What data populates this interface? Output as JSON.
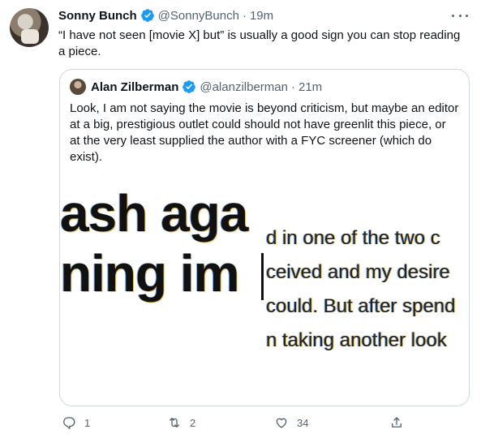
{
  "tweet": {
    "name": "Sonny Bunch",
    "handle": "@SonnyBunch",
    "separator": "·",
    "time": "19m",
    "text": "“I have not seen [movie X] but” is usually a good sign you can stop reading a piece."
  },
  "quote": {
    "name": "Alan Zilberman",
    "handle": "@alanzilberman",
    "separator": "·",
    "time": "21m",
    "text": "Look, I am not saying the movie is beyond criticism, but maybe an editor at a big, prestigious outlet could should not have greenlit this piece, or at the very least supplied the author with a FYC screener (which do exist).",
    "media": {
      "big_lines": [
        "ash aga",
        "ning im"
      ],
      "small_lines": [
        "d in one of the two c",
        "ceived and my desire",
        "could. But after spend",
        "n taking another look"
      ]
    }
  },
  "actions": {
    "reply_count": "1",
    "retweet_count": "2",
    "like_count": "34"
  },
  "icons": [
    "verified-icon",
    "more-icon",
    "reply-icon",
    "retweet-icon",
    "like-icon",
    "share-icon"
  ],
  "colors": {
    "verified": "#1d9bf0",
    "secondary_text": "#536471",
    "border": "#cfd9de"
  }
}
